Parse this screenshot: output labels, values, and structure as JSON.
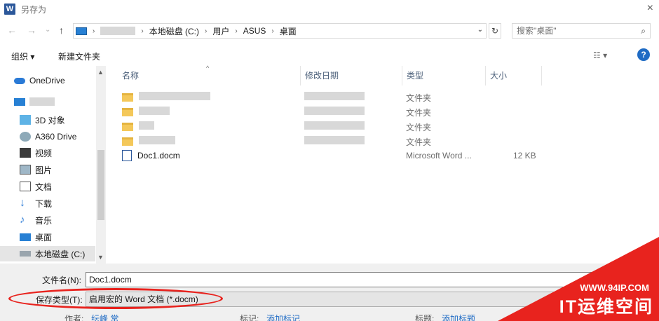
{
  "window": {
    "title": "另存为",
    "close_label": "×",
    "app_icon_label": "W"
  },
  "nav": {
    "back": "←",
    "forward": "→",
    "history": "⌄",
    "up": "↑"
  },
  "address": {
    "crumbs": [
      "本地磁盘 (C:)",
      "用户",
      "ASUS",
      "桌面"
    ],
    "separator": "›",
    "dropdown": "⌄",
    "refresh": "↻"
  },
  "search": {
    "placeholder": "搜索\"桌面\"",
    "icon": "search-icon"
  },
  "toolbar": {
    "organize": "组织 ▾",
    "new_folder": "新建文件夹",
    "view": "☷ ▾",
    "help": "?"
  },
  "sidebar": {
    "items": [
      {
        "label": "OneDrive",
        "icon": "onedrive-icon"
      },
      {
        "label": "",
        "icon": "computer-icon"
      },
      {
        "label": "3D 对象",
        "icon": "3d-objects-icon"
      },
      {
        "label": "A360 Drive",
        "icon": "a360-icon"
      },
      {
        "label": "视频",
        "icon": "video-icon"
      },
      {
        "label": "图片",
        "icon": "pictures-icon"
      },
      {
        "label": "文档",
        "icon": "documents-icon"
      },
      {
        "label": "下载",
        "icon": "downloads-icon"
      },
      {
        "label": "音乐",
        "icon": "music-icon"
      },
      {
        "label": "桌面",
        "icon": "desktop-icon"
      },
      {
        "label": "本地磁盘 (C:)",
        "icon": "drive-icon"
      }
    ]
  },
  "columns": {
    "name": "名称",
    "date": "修改日期",
    "type": "类型",
    "size": "大小"
  },
  "files": [
    {
      "name": "",
      "type": "文件夹",
      "size": ""
    },
    {
      "name": "",
      "type": "文件夹",
      "size": ""
    },
    {
      "name": "",
      "type": "文件夹",
      "size": ""
    },
    {
      "name": "",
      "type": "文件夹",
      "size": ""
    },
    {
      "name": "Doc1.docm",
      "type": "Microsoft Word ...",
      "size": "12 KB"
    }
  ],
  "form": {
    "filename_label": "文件名(N):",
    "filename_value": "Doc1.docm",
    "filetype_label": "保存类型(T):",
    "filetype_value": "启用宏的 Word 文档 (*.docm)",
    "author_label": "作者:",
    "author_value": "纭峰 常",
    "tags_label": "标记:",
    "tags_value": "添加标记",
    "title_label": "标题:",
    "title_value": "添加标题"
  },
  "watermark": {
    "url": "WWW.94IP.COM",
    "text": "IT运维空间"
  },
  "colors": {
    "accent": "#1f6bc4",
    "highlight": "#e8231e",
    "folder": "#f4c85a"
  }
}
